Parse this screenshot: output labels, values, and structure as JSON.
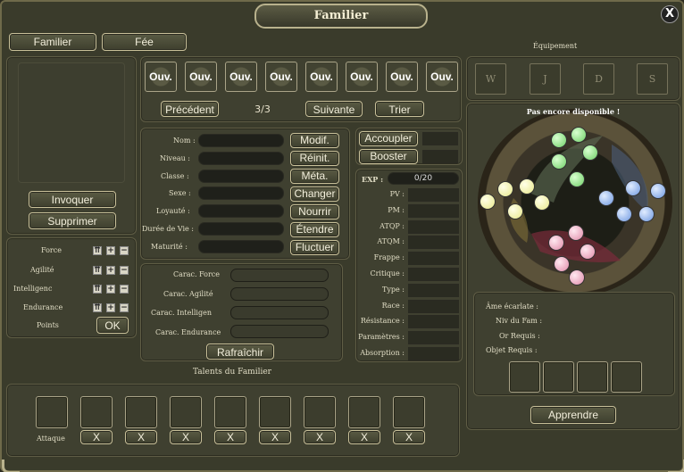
{
  "window": {
    "title": "Familier",
    "close_label": "X"
  },
  "tabs": [
    {
      "label": "Familier"
    },
    {
      "label": "Fée"
    }
  ],
  "left_actions": {
    "summon_label": "Invoquer",
    "delete_label": "Supprimer"
  },
  "stats": {
    "items": [
      {
        "label": "Force"
      },
      {
        "label": "Agilité"
      },
      {
        "label": "Intelligenc"
      },
      {
        "label": "Endurance"
      }
    ],
    "points_label": "Points",
    "ok_label": "OK"
  },
  "slots": {
    "open_labels": [
      "Ouv.",
      "Ouv.",
      "Ouv.",
      "Ouv.",
      "Ouv.",
      "Ouv.",
      "Ouv.",
      "Ouv."
    ],
    "prev_label": "Précédent",
    "page": "3/3",
    "next_label": "Suivante",
    "sort_label": "Trier"
  },
  "info": {
    "fields": [
      {
        "label": "Nom :",
        "action": "Modif."
      },
      {
        "label": "Niveau :",
        "action": "Réinit."
      },
      {
        "label": "Classe :",
        "action": "Méta."
      },
      {
        "label": "Sexe :",
        "action": "Changer"
      },
      {
        "label": "Loyauté :",
        "action": "Nourrir"
      },
      {
        "label": "Durée de Vie :",
        "action": "Étendre"
      },
      {
        "label": "Maturité :",
        "action": "Fluctuer"
      }
    ]
  },
  "carac": {
    "fields": [
      {
        "label": "Carac. Force"
      },
      {
        "label": "Carac. Agilité"
      },
      {
        "label": "Carac. Intelligen"
      },
      {
        "label": "Carac. Endurance"
      }
    ],
    "refresh_label": "Rafraîchir"
  },
  "talents": {
    "title": "Talents du Familier",
    "attack_label": "Attaque",
    "remove_labels": [
      "X",
      "X",
      "X",
      "X",
      "X",
      "X",
      "X",
      "X"
    ]
  },
  "combat": {
    "couple_label": "Accoupler",
    "boost_label": "Booster",
    "exp_label": "EXP :",
    "exp_value": "0/20",
    "attributes": [
      {
        "label": "PV :"
      },
      {
        "label": "PM :"
      },
      {
        "label": "ATQP :"
      },
      {
        "label": "ATQM :"
      },
      {
        "label": "Frappe :"
      },
      {
        "label": "Critique :"
      },
      {
        "label": "Type :"
      },
      {
        "label": "Race :"
      },
      {
        "label": "Résistance :"
      },
      {
        "label": "Paramètres :"
      },
      {
        "label": "Absorption :"
      }
    ]
  },
  "equipment": {
    "title": "Équipement",
    "slots": [
      "W",
      "J",
      "D",
      "S"
    ],
    "not_available": "Pas encore disponible !"
  },
  "requirements": {
    "lines": [
      {
        "label": "Âme écarlate :"
      },
      {
        "label": "Niv du Fam :"
      },
      {
        "label": "Or Requis :"
      },
      {
        "label": "Objet Requis :"
      }
    ],
    "learn_label": "Apprendre"
  },
  "colors": {
    "green_orb": "#7fe07a",
    "yellow_orb": "#f0f0a8",
    "blue_orb": "#7aa8f0",
    "pink_orb": "#f0a8c0"
  }
}
